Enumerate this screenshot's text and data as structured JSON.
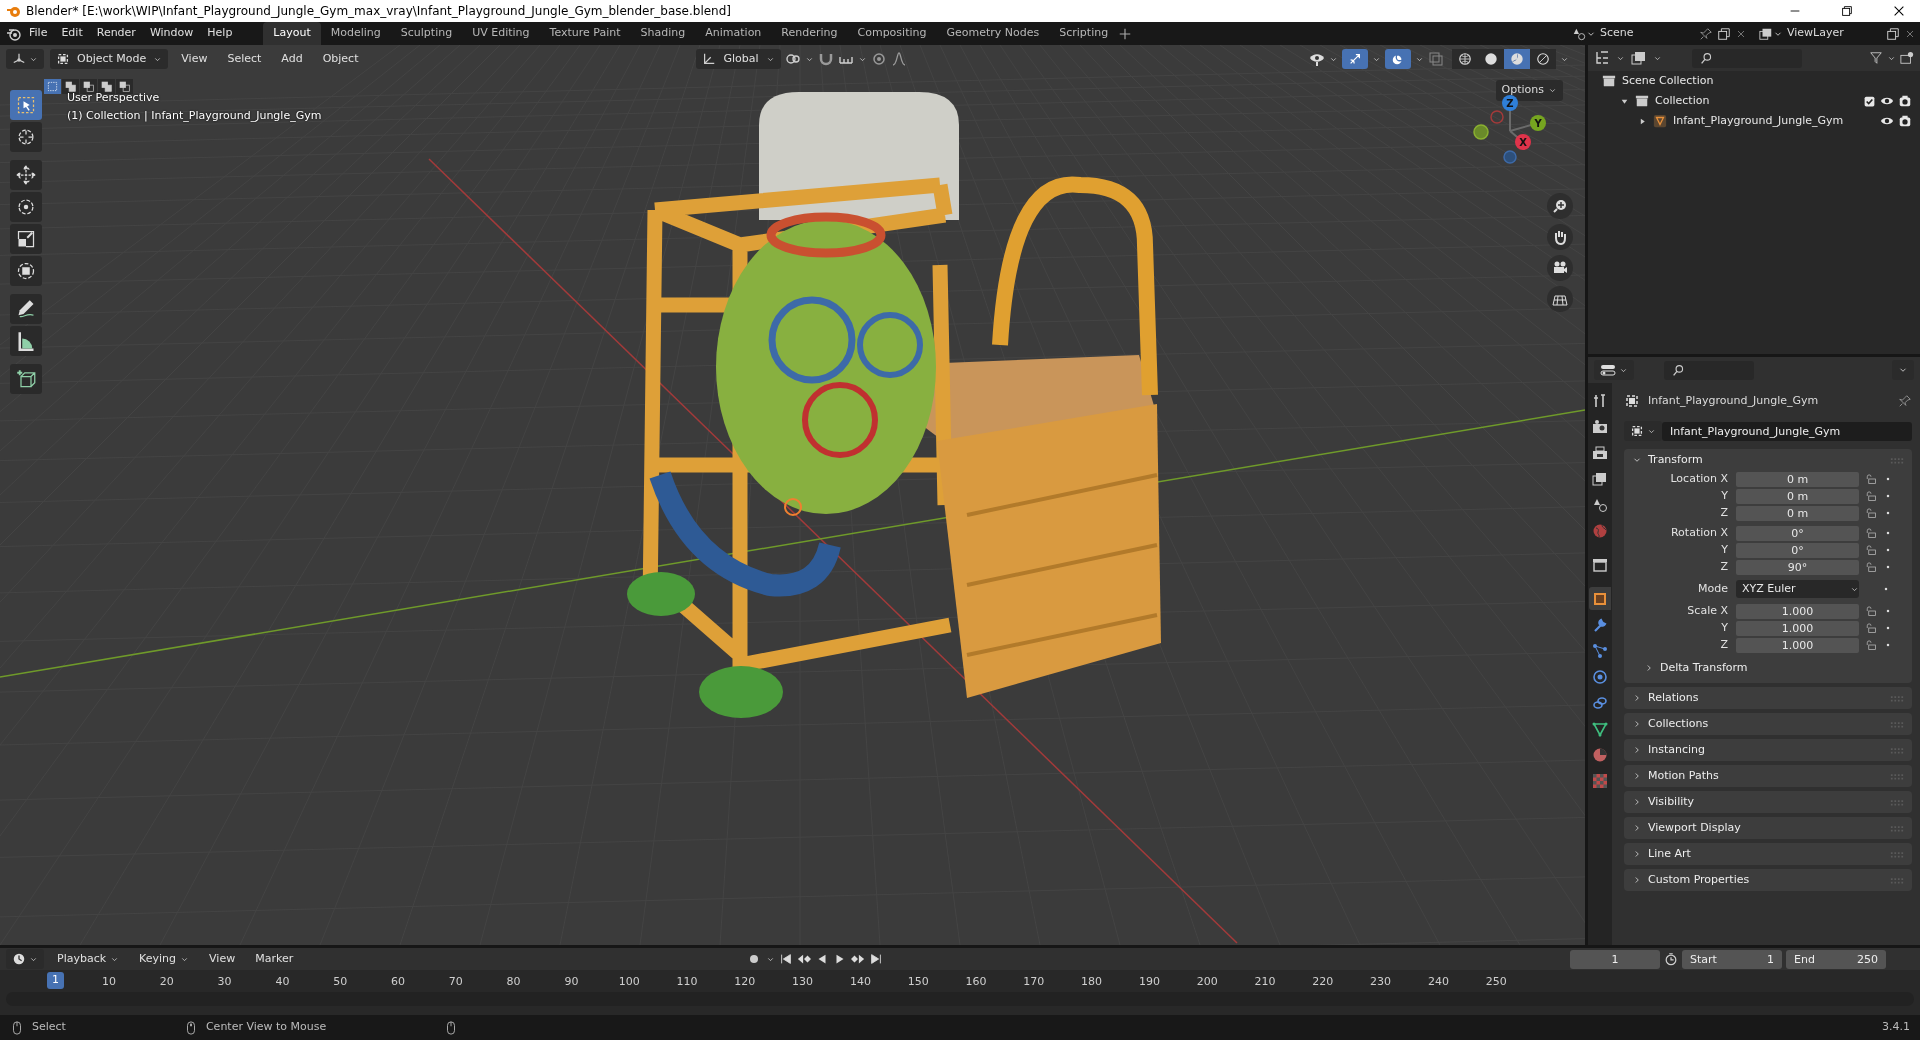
{
  "window": {
    "title": "Blender* [E:\\work\\WIP\\Infant_Playground_Jungle_Gym_max_vray\\Infant_Playground_Jungle_Gym_blender_base.blend]"
  },
  "menu": [
    "File",
    "Edit",
    "Render",
    "Window",
    "Help"
  ],
  "workspaces": [
    {
      "label": "Layout",
      "selected": true
    },
    {
      "label": "Modeling",
      "selected": false
    },
    {
      "label": "Sculpting",
      "selected": false
    },
    {
      "label": "UV Editing",
      "selected": false
    },
    {
      "label": "Texture Paint",
      "selected": false
    },
    {
      "label": "Shading",
      "selected": false
    },
    {
      "label": "Animation",
      "selected": false
    },
    {
      "label": "Rendering",
      "selected": false
    },
    {
      "label": "Compositing",
      "selected": false
    },
    {
      "label": "Geometry Nodes",
      "selected": false
    },
    {
      "label": "Scripting",
      "selected": false
    }
  ],
  "scene": {
    "name": "Scene"
  },
  "view_layer": {
    "name": "ViewLayer"
  },
  "viewport": {
    "mode": "Object Mode",
    "menus": [
      "View",
      "Select",
      "Add",
      "Object"
    ],
    "orientation": "Global",
    "options": "Options",
    "overlay_lines": [
      "User Perspective",
      "(1) Collection | Infant_Playground_Jungle_Gym"
    ],
    "select_modes": [
      {
        "selected": true
      },
      {
        "selected": false
      },
      {
        "selected": false
      },
      {
        "selected": false
      },
      {
        "selected": false
      }
    ],
    "tools": [
      {
        "kind": "select",
        "selected": true
      },
      {
        "kind": "cursor",
        "selected": false
      },
      {
        "kind": "move",
        "selected": false
      },
      {
        "kind": "rotate",
        "selected": false
      },
      {
        "kind": "scale",
        "selected": false
      },
      {
        "kind": "transform",
        "selected": false
      },
      {
        "kind": "annotate",
        "selected": false
      },
      {
        "kind": "measure",
        "selected": false
      },
      {
        "kind": "add-cube",
        "selected": false
      }
    ],
    "gizmos": {
      "on": true
    },
    "overlays": {
      "on": true
    },
    "shading": [
      {
        "kind": "wireframe",
        "selected": false
      },
      {
        "kind": "solid",
        "selected": false
      },
      {
        "kind": "material",
        "selected": true
      },
      {
        "kind": "rendered",
        "selected": false
      }
    ],
    "gizmo_axes": [
      "Z",
      "Y",
      "X"
    ]
  },
  "outliner": {
    "items": [
      {
        "label": "Scene Collection",
        "children": [
          {
            "label": "Collection",
            "expanded": true,
            "checked": true,
            "children": [
              {
                "label": "Infant_Playground_Jungle_Gym",
                "expanded": false
              }
            ]
          }
        ]
      }
    ]
  },
  "properties": {
    "tabs": [
      {
        "kind": "tool",
        "selected": false
      },
      {
        "kind": "render",
        "selected": false
      },
      {
        "kind": "output",
        "selected": false
      },
      {
        "kind": "view-layer",
        "selected": false
      },
      {
        "kind": "scene",
        "selected": false
      },
      {
        "kind": "world",
        "selected": false
      },
      {
        "kind": "collection",
        "selected": false
      },
      {
        "kind": "object",
        "selected": true
      },
      {
        "kind": "modifiers",
        "selected": false
      },
      {
        "kind": "particles",
        "selected": false
      },
      {
        "kind": "physics",
        "selected": false
      },
      {
        "kind": "constraints",
        "selected": false
      },
      {
        "kind": "data",
        "selected": false
      },
      {
        "kind": "material",
        "selected": false
      },
      {
        "kind": "texture",
        "selected": false
      }
    ],
    "object_name": "Infant_Playground_Jungle_Gym",
    "name_field": "Infant_Playground_Jungle_Gym",
    "transform": {
      "label": "Transform",
      "expanded": true,
      "groups": [
        {
          "kind": "fields",
          "rows": [
            {
              "label": "Location X",
              "value": "0 m"
            },
            {
              "label": "Y",
              "value": "0 m"
            },
            {
              "label": "Z",
              "value": "0 m"
            }
          ]
        },
        {
          "kind": "fields",
          "rows": [
            {
              "label": "Rotation X",
              "value": "0°"
            },
            {
              "label": "Y",
              "value": "0°"
            },
            {
              "label": "Z",
              "value": "90°"
            }
          ]
        },
        {
          "kind": "dropdown",
          "rows": [
            {
              "label": "Mode",
              "value": "XYZ Euler"
            }
          ]
        },
        {
          "kind": "fields",
          "rows": [
            {
              "label": "Scale X",
              "value": "1.000"
            },
            {
              "label": "Y",
              "value": "1.000"
            },
            {
              "label": "Z",
              "value": "1.000"
            }
          ]
        }
      ],
      "subpanel": {
        "label": "Delta Transform",
        "expanded": false
      }
    },
    "panels": [
      {
        "label": "Relations",
        "expanded": false
      },
      {
        "label": "Collections",
        "expanded": false
      },
      {
        "label": "Instancing",
        "expanded": false
      },
      {
        "label": "Motion Paths",
        "expanded": false
      },
      {
        "label": "Visibility",
        "expanded": false
      },
      {
        "label": "Viewport Display",
        "expanded": false
      },
      {
        "label": "Line Art",
        "expanded": false
      },
      {
        "label": "Custom Properties",
        "expanded": false
      }
    ]
  },
  "timeline": {
    "menus": [
      {
        "label": "Playback",
        "dropdown": true
      },
      {
        "label": "Keying",
        "dropdown": true
      },
      {
        "label": "View",
        "dropdown": false
      },
      {
        "label": "Marker",
        "dropdown": false
      }
    ],
    "current_frame": "1",
    "start_label": "Start",
    "start": "1",
    "end_label": "End",
    "end": "250",
    "playhead": "1",
    "ticks": [
      "10",
      "20",
      "30",
      "40",
      "50",
      "60",
      "70",
      "80",
      "90",
      "100",
      "110",
      "120",
      "130",
      "140",
      "150",
      "160",
      "170",
      "180",
      "190",
      "200",
      "210",
      "220",
      "230",
      "240",
      "250"
    ]
  },
  "status_bar": {
    "hints": [
      "Select",
      "Center View to Mouse"
    ],
    "version": "3.4.1"
  }
}
